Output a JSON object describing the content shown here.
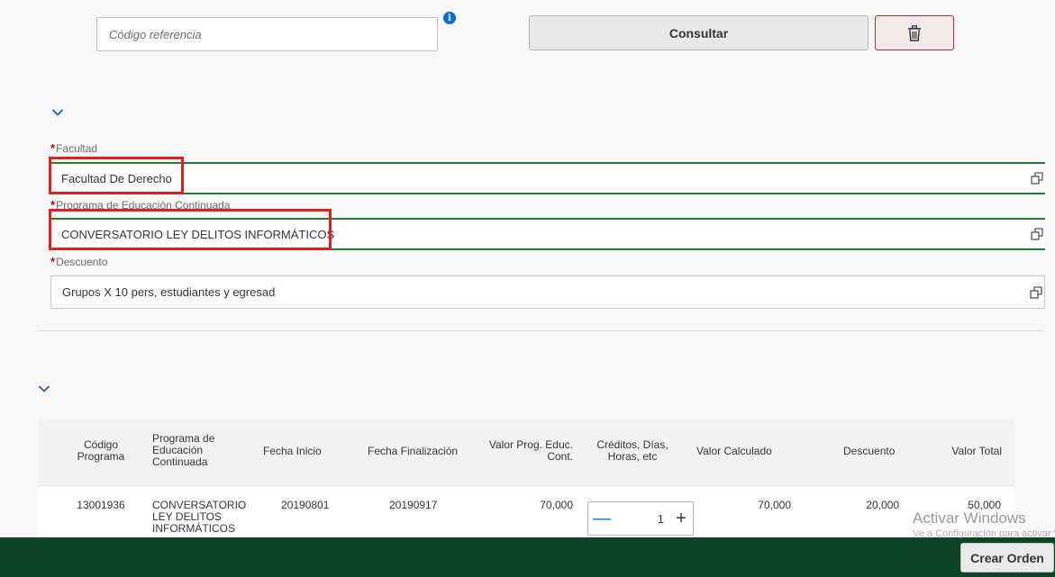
{
  "search": {
    "placeholder": "Código referencia",
    "consult_label": "Consultar"
  },
  "form": {
    "required_mark": "*",
    "facultad": {
      "label": "Facultad",
      "value": "Facultad De Derecho"
    },
    "programa": {
      "label": "Programa de Educación Continuada",
      "value": "CONVERSATORIO LEY DELITOS INFORMÁTICOS"
    },
    "descuento": {
      "label": "Descuento",
      "value": "Grupos X 10 pers, estudiantes y egresad"
    }
  },
  "table": {
    "headers": {
      "codigo": "Código Programa",
      "programa": "Programa de Educación Continuada",
      "fecha_inicio": "Fecha Inicio",
      "fecha_fin": "Fecha Finalización",
      "valor_prog": "Valor Prog. Educ. Cont.",
      "creditos": "Créditos, Días, Horas, etc",
      "valor_calc": "Valor Calculado",
      "descuento": "Descuento",
      "valor_total": "Valor Total"
    },
    "row": {
      "codigo": "13001936",
      "programa": "CONVERSATORIO LEY DELITOS INFORMÁTICOS",
      "fecha_inicio": "20190801",
      "fecha_fin": "20190917",
      "valor_prog": "70,000",
      "cantidad": "1",
      "valor_calc": "70,000",
      "descuento": "20,000",
      "valor_total": "50,000"
    }
  },
  "footer": {
    "crear_label": "Crear Orden"
  },
  "watermark": {
    "title": "Activar Windows",
    "subtitle": "Ve a Configuración para activar Windows."
  },
  "icons": {
    "info": "info-icon",
    "trash": "trash-icon",
    "chevron": "chevron-down-icon",
    "value_help": "value-help-icon"
  },
  "colors": {
    "valid_border": "#2b7d2b",
    "highlight": "#e0201f",
    "footer_bg": "#0d4425",
    "accent": "#0a6ed1"
  }
}
